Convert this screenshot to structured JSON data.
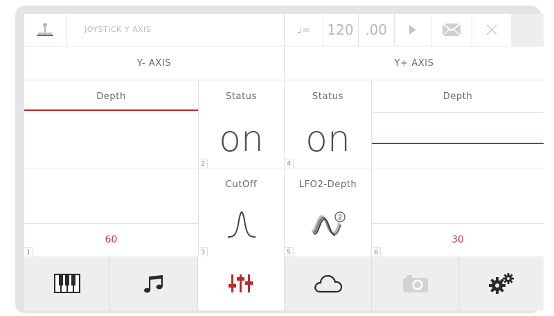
{
  "top_bar": {
    "mode_label": "JOYSTICK Y AXIS",
    "tempo_symbol": "♩=",
    "tempo_value": "120",
    "tempo_fraction": ".00",
    "icons": [
      "joystick-icon",
      "tempo-note-icon",
      "play-icon",
      "mail-icon",
      "close-icon"
    ]
  },
  "axis_headers": {
    "left": "Y- AXIS",
    "right": "Y+ AXIS"
  },
  "slots": [
    {
      "number": "1",
      "label": "Depth",
      "value": "60"
    },
    {
      "number": "2",
      "label": "Status",
      "value": "on"
    },
    {
      "number": "3",
      "label": "CutOff",
      "icon": "lowpass-curve-icon"
    },
    {
      "number": "4",
      "label": "Status",
      "value": "on"
    },
    {
      "number": "5",
      "label": "LFO2-Depth",
      "icon": "lfo2-wave-icon",
      "badge": "2"
    },
    {
      "number": "6",
      "label": "Depth",
      "value": "30"
    }
  ],
  "depth_levels": {
    "left": 0.65,
    "right": 0.35
  },
  "bottom_nav": {
    "items": [
      "piano-keys-icon",
      "music-notes-icon",
      "mixer-sliders-icon",
      "cloud-icon",
      "camera-icon",
      "gears-icon"
    ],
    "active": "mixer-sliders-icon"
  },
  "colors": {
    "accent": "#c0272d",
    "text": "#555555",
    "disabled": "#c8c8c8"
  }
}
